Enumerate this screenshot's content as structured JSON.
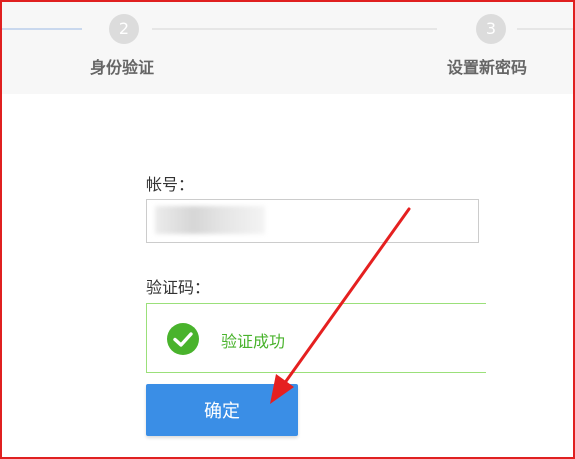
{
  "steps": [
    {
      "number": "2",
      "label": "身份验证"
    },
    {
      "number": "3",
      "label": "设置新密码"
    }
  ],
  "form": {
    "account_label": "帐号：",
    "account_value": "",
    "captcha_label": "验证码：",
    "captcha_status": "验证成功",
    "confirm_label": "确定"
  },
  "colors": {
    "annotation_border": "#e02020",
    "success_green": "#49b32c",
    "button_blue": "#3a8ee6"
  },
  "icons": {
    "success": "check-circle-icon",
    "annotation": "red-arrow-icon"
  }
}
